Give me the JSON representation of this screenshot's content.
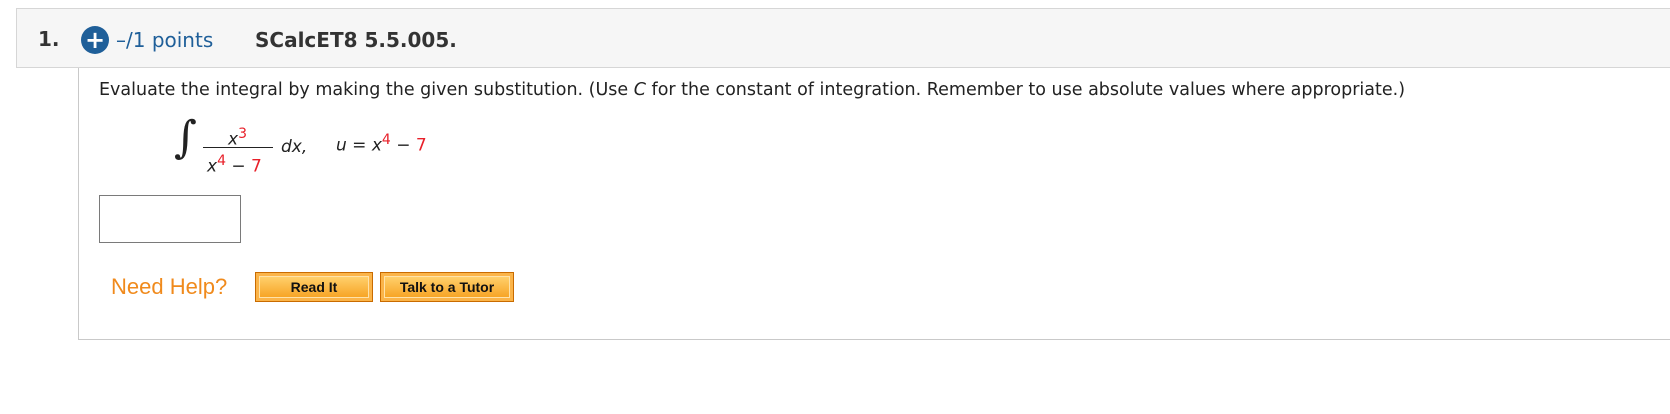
{
  "question": {
    "number": "1.",
    "add_icon": "plus-circle-icon",
    "points": "–/1 points",
    "code": "SCalcET8 5.5.005."
  },
  "instructions": {
    "part1": "Evaluate the integral by making the given substitution. (Use ",
    "var": "C",
    "part2": " for the constant of integration. Remember to use absolute values where appropriate.)"
  },
  "integral": {
    "sign": "∫",
    "numerator_base": "x",
    "numerator_exp": "3",
    "denominator_base": "x",
    "denominator_exp": "4",
    "denominator_op": " − ",
    "denominator_const": "7",
    "differential": "dx,",
    "sub_lhs": "u = x",
    "sub_exp": "4",
    "sub_op": " − ",
    "sub_const": "7"
  },
  "answer": {
    "value": ""
  },
  "help": {
    "label": "Need Help?",
    "read_it": "Read It",
    "tutor": "Talk to a Tutor"
  },
  "colors": {
    "accent_blue": "#1f5f99",
    "constant_red": "#e8202a",
    "help_orange": "#f08a1c"
  }
}
